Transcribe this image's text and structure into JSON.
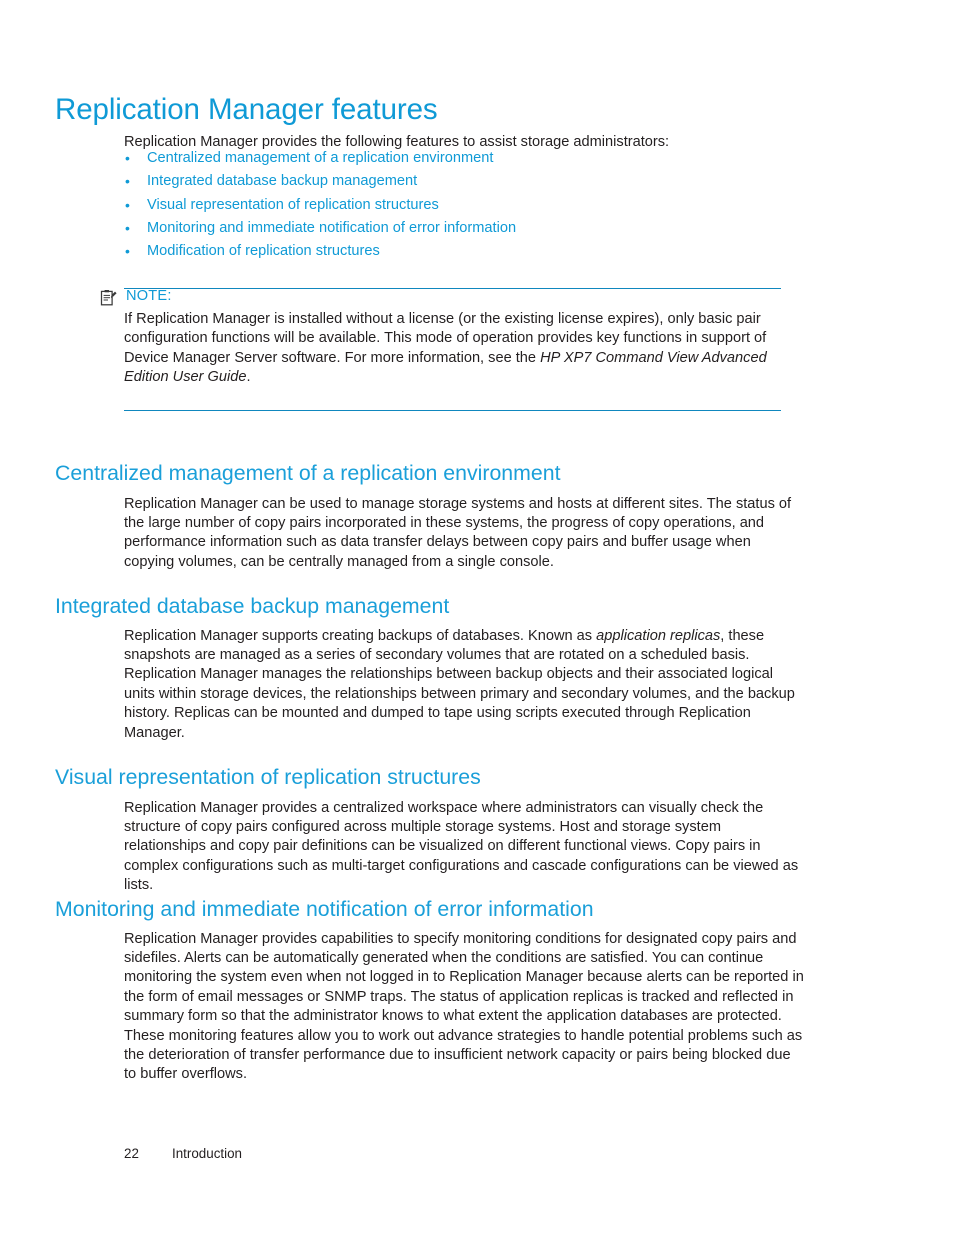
{
  "document": {
    "title": "Replication Manager features",
    "intro": "Replication Manager provides the following features to assist storage administrators:",
    "feature_links": [
      "Centralized management of a replication environment",
      "Integrated database backup management",
      "Visual representation of replication structures",
      "Monitoring and immediate notification of error information",
      "Modification of replication structures"
    ],
    "note": {
      "icon": "note-clipboard-pencil-icon",
      "label": "NOTE:",
      "text_part1": "If Replication Manager is installed without a license (or the existing license expires), only basic pair configuration functions will be available. This mode of operation provides key functions in support of Device Manager Server software. For more information, see the ",
      "text_italic": "HP XP7 Command View Advanced Edition User Guide",
      "text_part2": "."
    },
    "sections": [
      {
        "heading": "Centralized management of a replication environment",
        "body": "Replication Manager can be used to manage storage systems and hosts at different sites. The status of the large number of copy pairs incorporated in these systems, the progress of copy operations, and performance information such as data transfer delays between copy pairs and buffer usage when copying volumes, can be centrally managed from a single console."
      },
      {
        "heading": "Integrated database backup management",
        "body_part1": "Replication Manager supports creating backups of databases. Known as ",
        "body_italic": "application replicas",
        "body_part2": ", these snapshots are managed as a series of secondary volumes that are rotated on a scheduled basis. Replication Manager manages the relationships between backup objects and their associated logical units within storage devices, the relationships between primary and secondary volumes, and the backup history. Replicas can be mounted and dumped to tape using scripts executed through Replication Manager."
      },
      {
        "heading": "Visual representation of replication structures",
        "body": "Replication Manager provides a centralized workspace where administrators can visually check the structure of copy pairs configured across multiple storage systems. Host and storage system relationships and copy pair definitions can be visualized on different functional views. Copy pairs in complex configurations such as multi-target configurations and cascade configurations can be viewed as lists."
      },
      {
        "heading": "Monitoring and immediate notification of error information",
        "body": "Replication Manager provides capabilities to specify monitoring conditions for designated copy pairs and sidefiles. Alerts can be automatically generated when the conditions are satisfied. You can continue monitoring the system even when not logged in to Replication Manager because alerts can be reported in the form of email messages or SNMP traps. The status of application replicas is tracked and reflected in summary form so that the administrator knows to what extent the application databases are protected. These monitoring features allow you to work out advance strategies to handle potential problems such as the deterioration of transfer performance due to insufficient network capacity or pairs being blocked due to buffer overflows."
      }
    ],
    "footer": {
      "page_number": "22",
      "chapter": "Introduction"
    },
    "colors": {
      "heading_blue": "#0f9ad6",
      "link_blue": "#0f9ad6",
      "rule_blue": "#0f87be",
      "body_text": "#231f20",
      "background": "#ffffff"
    }
  }
}
